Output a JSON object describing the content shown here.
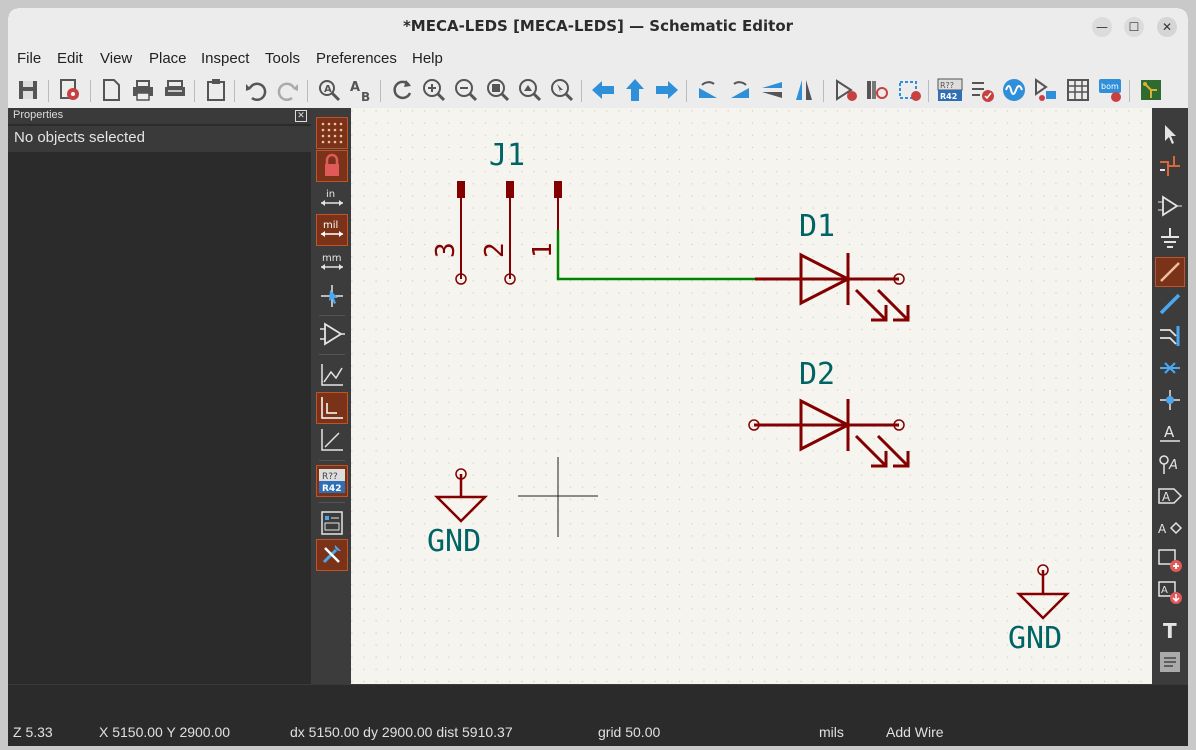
{
  "window": {
    "title": "*MECA-LEDS [MECA-LEDS] — Schematic Editor"
  },
  "menu": [
    "File",
    "Edit",
    "View",
    "Place",
    "Inspect",
    "Tools",
    "Preferences",
    "Help"
  ],
  "toolbar_icons": [
    "save-icon",
    "schematic-setup-icon",
    "page-settings-icon",
    "print-icon",
    "plot-icon",
    "paste-icon",
    "undo-icon",
    "redo-icon",
    "find-icon",
    "find-replace-icon",
    "refresh-icon",
    "zoom-in-icon",
    "zoom-out-icon",
    "zoom-fit-icon",
    "zoom-objects-icon",
    "zoom-selection-icon",
    "navigate-back-icon",
    "navigate-up-icon",
    "navigate-forward-icon",
    "rotate-ccw-icon",
    "rotate-cw-icon",
    "mirror-vertical-icon",
    "mirror-horizontal-icon",
    "symbol-editor-icon",
    "symbol-browser-icon",
    "footprint-editor-icon",
    "annotate-icon",
    "erc-icon",
    "simulator-icon",
    "assign-footprints-icon",
    "edit-fields-icon",
    "bom-icon",
    "pcb-editor-icon"
  ],
  "annotate_icon_text": {
    "top": "R??",
    "bottom": "R42"
  },
  "properties": {
    "title": "Properties",
    "close": "✕",
    "empty_message": "No objects selected"
  },
  "left_toolbar": {
    "units": {
      "inches": "in",
      "mils": "mil",
      "millimeters": "mm"
    },
    "annotate_top": "R??",
    "annotate_bottom": "R42"
  },
  "right_toolbar": {
    "label_text": "A",
    "text_tool": "T"
  },
  "schematic": {
    "connector": {
      "ref": "J1",
      "pins": [
        "3",
        "2",
        "1"
      ]
    },
    "diodes": [
      {
        "ref": "D1"
      },
      {
        "ref": "D2"
      }
    ],
    "power": [
      {
        "value": "GND"
      },
      {
        "value": "GND"
      }
    ]
  },
  "colors": {
    "symbol": "#840000",
    "wire": "#008400",
    "reference_text": "#006464",
    "canvas_bg": "#f5f4ef",
    "active_tool": "#7a3219"
  },
  "status": {
    "zoom": "Z 5.33",
    "xy": "X 5150.00  Y 2900.00",
    "delta": "dx 5150.00  dy 2900.00  dist 5910.37",
    "grid": "grid 50.00",
    "units": "mils",
    "mode": "Add Wire"
  }
}
